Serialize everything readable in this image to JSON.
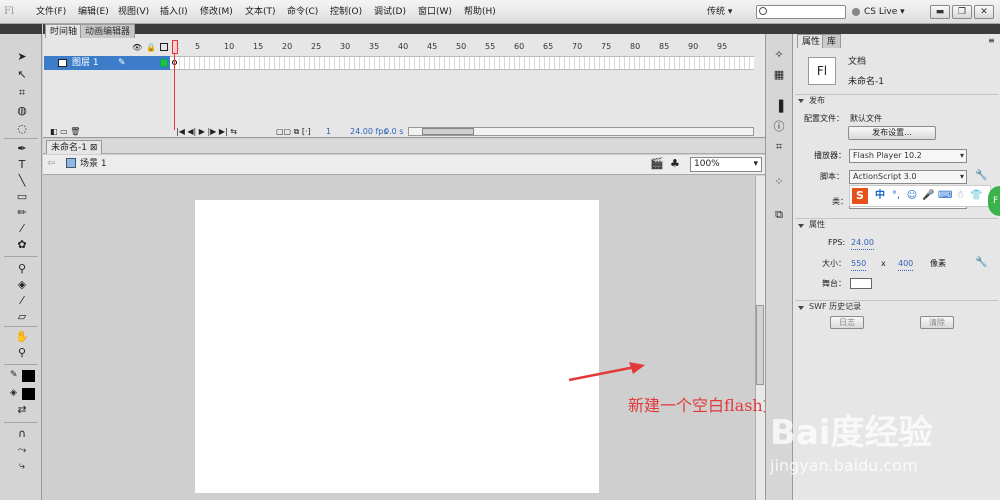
{
  "app": {
    "logo": "Fl"
  },
  "menu": [
    "文件(F)",
    "编辑(E)",
    "视图(V)",
    "插入(I)",
    "修改(M)",
    "文本(T)",
    "命令(C)",
    "控制(O)",
    "调试(D)",
    "窗口(W)",
    "帮助(H)"
  ],
  "header": {
    "workspace": "传统 ▾",
    "search_value": "",
    "cs_live": "CS Live ▾",
    "win_buttons": [
      "▬",
      "❐",
      "✕"
    ]
  },
  "timeline": {
    "tabs": [
      "时间轴",
      "动画编辑器"
    ],
    "frame_numbers": [
      "1",
      "5",
      "10",
      "15",
      "20",
      "25",
      "30",
      "35",
      "40",
      "45",
      "50",
      "55",
      "60",
      "65",
      "70",
      "75",
      "80",
      "85",
      "90",
      "95"
    ],
    "layer_name": "图层 1",
    "fps": "24.00 fps",
    "time": "0.0 s",
    "current_frame": "1"
  },
  "document": {
    "tab": "未命名-1",
    "scene": "场景 1",
    "zoom": "100%"
  },
  "properties": {
    "tabs": [
      "属性",
      "库"
    ],
    "doc_icon": "Fl",
    "doc_type": "文档",
    "doc_name": "未命名-1",
    "sections": {
      "publish": "发布",
      "properties": "属性",
      "swf_history": "SWF 历史记录"
    },
    "profile_label": "配置文件：",
    "profile_value": "默认文件",
    "publish_settings_btn": "发布设置...",
    "player_label": "播放器：",
    "player_value": "Flash Player 10.2",
    "script_label": "脚本：",
    "script_value": "ActionScript 3.0",
    "class_label": "类：",
    "fps_label": "FPS:",
    "fps_value": "24.00",
    "size_label": "大小：",
    "width": "550",
    "x": "x",
    "height": "400",
    "unit": "像素",
    "stage_label": "舞台：",
    "log_btn": "日志",
    "clear_btn": "清除"
  },
  "ime": {
    "logo": "S",
    "mode": "中"
  },
  "annotation": "新建一个空白flash文档",
  "watermark": {
    "brand": "Bai度经验",
    "url": "jingyan.baidu.com"
  },
  "colors": {
    "accent_layer": "#3d7cc9",
    "annotation": "#e23a3a",
    "stage": "#ffffff",
    "playhead": "#e33333"
  }
}
